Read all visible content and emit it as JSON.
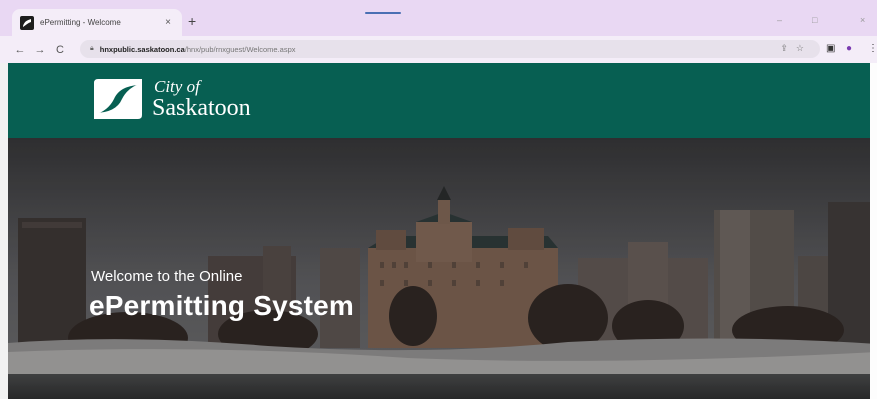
{
  "browser": {
    "tab_title": "ePermitting - Welcome",
    "tab_close": "×",
    "new_tab": "+",
    "url_host": "hnxpublic.saskatoon.ca",
    "url_path": "/hnx/pub/rnxguest/Welcome.aspx",
    "back": "←",
    "forward": "→",
    "reload": "C",
    "minimize": "–",
    "restore": "□",
    "close": "×"
  },
  "site": {
    "logo_city": "City of",
    "logo_name": "Saskatoon",
    "brand_color": "#075f52"
  },
  "hero": {
    "subtitle": "Welcome to the Online",
    "title": "ePermitting System"
  }
}
